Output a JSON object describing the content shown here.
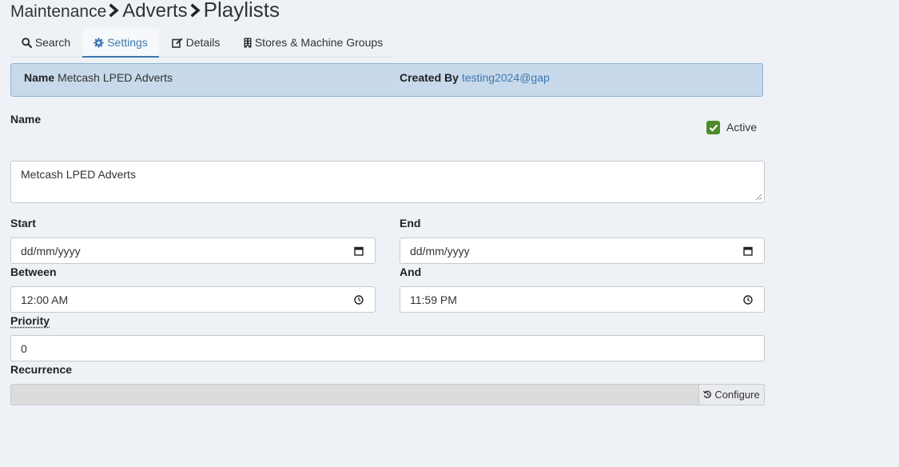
{
  "breadcrumb": {
    "level1": "Maintenance",
    "level2": "Adverts",
    "level3": "Playlists"
  },
  "tabs": [
    {
      "label": "Search",
      "icon": "search-icon"
    },
    {
      "label": "Settings",
      "icon": "gear-icon",
      "active": true
    },
    {
      "label": "Details",
      "icon": "edit-icon"
    },
    {
      "label": "Stores & Machine Groups",
      "icon": "building-icon"
    }
  ],
  "info": {
    "name_label": "Name",
    "name_value": "Metcash LPED Adverts",
    "created_label": "Created By",
    "created_value": "testing2024@gap"
  },
  "form": {
    "name_label": "Name",
    "name_value": "Metcash LPED Adverts",
    "active_label": "Active",
    "active_checked": true,
    "start_label": "Start",
    "start_placeholder": "dd/mm/yyyy",
    "end_label": "End",
    "end_placeholder": "dd/mm/yyyy",
    "between_label": "Between",
    "between_value": "12:00 AM",
    "and_label": "And",
    "and_value": "11:59 PM",
    "priority_label": "Priority",
    "priority_value": "0",
    "recurrence_label": "Recurrence",
    "recurrence_value": "",
    "configure_label": "Configure"
  },
  "colors": {
    "accent": "#3d78b3",
    "info_bg": "#c7d9ea",
    "checkbox": "#4c8a2c",
    "page_bg": "#eef2f6"
  }
}
